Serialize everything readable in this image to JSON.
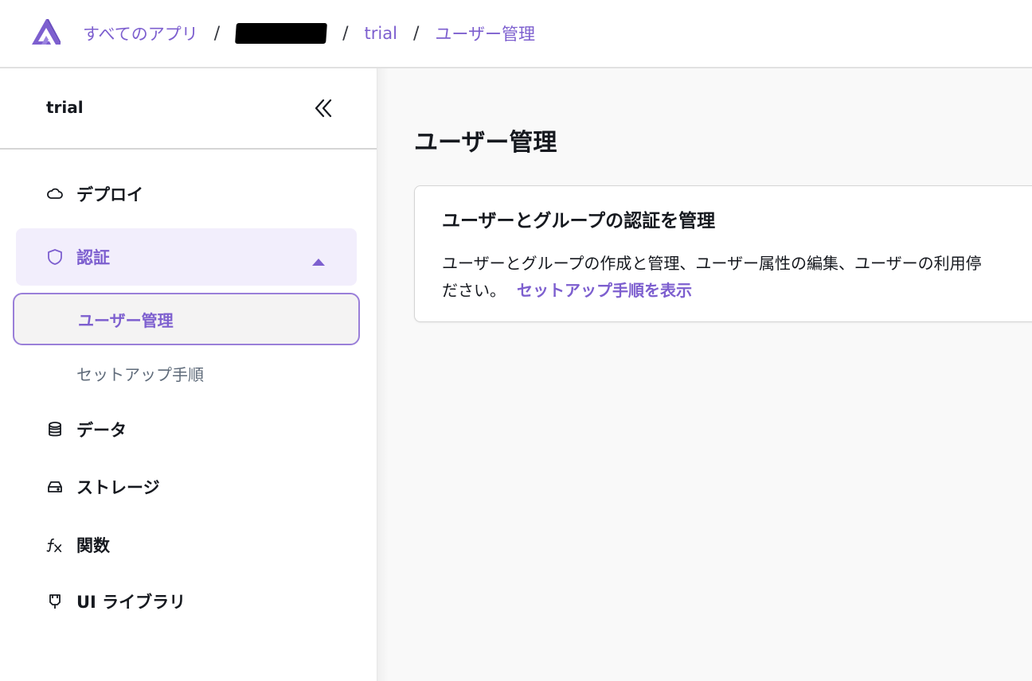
{
  "breadcrumb": {
    "all_apps": "すべてのアプリ",
    "app": "trial",
    "current": "ユーザー管理",
    "separator": "/"
  },
  "sidebar": {
    "app_name": "trial",
    "items": [
      {
        "label": "デプロイ",
        "icon": "cloud-icon"
      },
      {
        "label": "認証",
        "icon": "shield-icon",
        "expanded": true
      },
      {
        "label": "データ",
        "icon": "database-icon"
      },
      {
        "label": "ストレージ",
        "icon": "storage-icon"
      },
      {
        "label": "関数",
        "icon": "function-icon"
      },
      {
        "label": "UI ライブラリ",
        "icon": "plug-icon"
      }
    ],
    "auth_sub_items": [
      {
        "label": "ユーザー管理",
        "selected": true
      },
      {
        "label": "セットアップ手順",
        "selected": false
      }
    ]
  },
  "main": {
    "title": "ユーザー管理",
    "card": {
      "title": "ユーザーとグループの認証を管理",
      "body_line1": "ユーザーとグループの作成と管理、ユーザー属性の編集、ユーザーの利用停",
      "body_line2": "ださい。",
      "link": "セットアップ手順を表示"
    }
  },
  "colors": {
    "accent": "#7d5fcf",
    "active_bg": "#f2eefc",
    "text": "#16191f",
    "muted": "#5f6b7a"
  }
}
